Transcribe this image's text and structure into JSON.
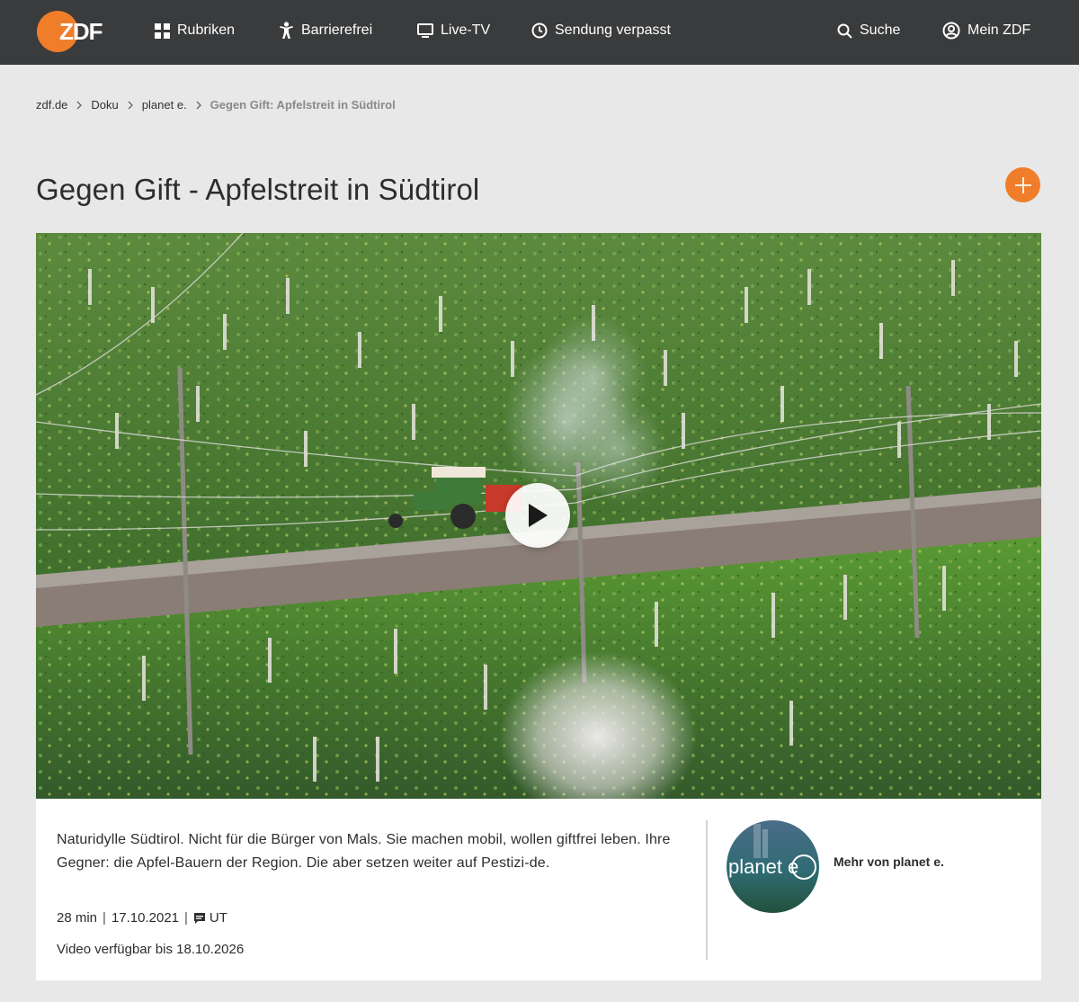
{
  "header": {
    "logo_text": "ZDF",
    "nav": [
      {
        "label": "Rubriken",
        "icon": "grid-icon"
      },
      {
        "label": "Barrierefrei",
        "icon": "accessibility-icon"
      },
      {
        "label": "Live-TV",
        "icon": "tv-icon"
      },
      {
        "label": "Sendung verpasst",
        "icon": "clock-icon"
      }
    ],
    "search_label": "Suche",
    "account_label": "Mein ZDF"
  },
  "breadcrumb": [
    {
      "label": "zdf.de"
    },
    {
      "label": "Doku"
    },
    {
      "label": "planet e."
    },
    {
      "label": "Gegen Gift: Apfelstreit in Südtirol"
    }
  ],
  "page": {
    "title": "Gegen Gift - Apfelstreit in Südtirol"
  },
  "video": {
    "play_icon": "play-icon"
  },
  "info": {
    "description": "Naturidylle Südtirol. Nicht für die Bürger von Mals. Sie machen mobil, wollen giftfrei leben. Ihre Gegner: die Apfel-Bauern der Region. Die aber setzen weiter auf Pestizi-de.",
    "duration": "28 min",
    "date": "17.10.2021",
    "subtitles": "UT",
    "availability": "Video verfügbar bis 18.10.2026",
    "brand_logo_text": "planet e",
    "brand_link": "Mehr von planet e."
  },
  "colors": {
    "accent": "#f07d2a",
    "header_bg": "#3a3b3c",
    "page_bg": "#e8e8e8"
  }
}
